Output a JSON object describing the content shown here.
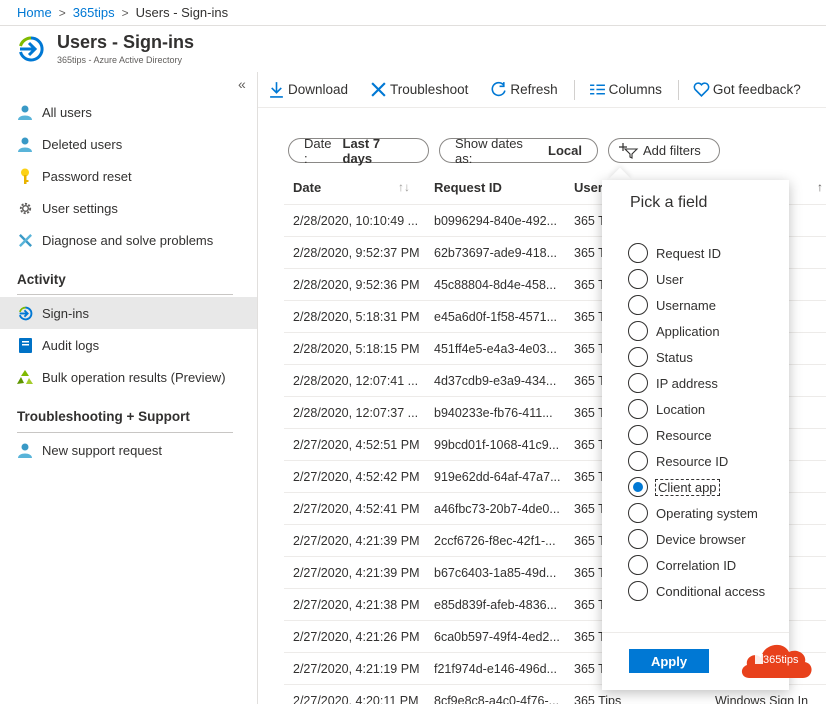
{
  "breadcrumb": {
    "home": "Home",
    "tenant": "365tips",
    "current": "Users - Sign-ins",
    "separator": ">"
  },
  "header": {
    "title": "Users - Sign-ins",
    "subtitle": "365tips - Azure Active Directory"
  },
  "sidebar": {
    "collapse_glyph": "«",
    "items": [
      {
        "label": "All users",
        "icon": "user-icon"
      },
      {
        "label": "Deleted users",
        "icon": "user-icon"
      },
      {
        "label": "Password reset",
        "icon": "key-icon"
      },
      {
        "label": "User settings",
        "icon": "gear-icon"
      },
      {
        "label": "Diagnose and solve problems",
        "icon": "wrench-icon"
      }
    ],
    "section_activity": "Activity",
    "activity_items": [
      {
        "label": "Sign-ins",
        "icon": "signin-icon",
        "active": true
      },
      {
        "label": "Audit logs",
        "icon": "book-icon"
      },
      {
        "label": "Bulk operation results (Preview)",
        "icon": "recycle-icon"
      }
    ],
    "section_support": "Troubleshooting + Support",
    "support_items": [
      {
        "label": "New support request",
        "icon": "user-icon"
      }
    ]
  },
  "toolbar": {
    "download": "Download",
    "troubleshoot": "Troubleshoot",
    "refresh": "Refresh",
    "columns": "Columns",
    "feedback": "Got feedback?"
  },
  "filters": {
    "date_label": "Date :",
    "date_value": "Last 7 days",
    "show_dates_label": "Show dates as:",
    "show_dates_value": "Local",
    "add_filters": "Add filters"
  },
  "table": {
    "columns": [
      "Date",
      "Request ID",
      "User"
    ],
    "rows": [
      [
        "2/28/2020, 10:10:49 ...",
        "b0996294-840e-492...",
        "365 T",
        ""
      ],
      [
        "2/28/2020, 9:52:37 PM",
        "62b73697-ade9-418...",
        "365 T",
        "n In"
      ],
      [
        "2/28/2020, 9:52:36 PM",
        "45c88804-8d4e-458...",
        "365 T",
        "n In"
      ],
      [
        "2/28/2020, 5:18:31 PM",
        "e45a6d0f-1f58-4571...",
        "365 T",
        "fice"
      ],
      [
        "2/28/2020, 5:18:15 PM",
        "451ff4e5-e4a3-4e03...",
        "365 T",
        "fice"
      ],
      [
        "2/28/2020, 12:07:41 ...",
        "4d37cdb9-e3a9-434...",
        "365 T",
        ""
      ],
      [
        "2/28/2020, 12:07:37 ...",
        "b940233e-fb76-411...",
        "365 T",
        ""
      ],
      [
        "2/27/2020, 4:52:51 PM",
        "99bcd01f-1068-41c9...",
        "365 T",
        ""
      ],
      [
        "2/27/2020, 4:52:42 PM",
        "919e62dd-64af-47a7...",
        "365 T",
        "n In"
      ],
      [
        "2/27/2020, 4:52:41 PM",
        "a46fbc73-20b7-4de0...",
        "365 T",
        "n In"
      ],
      [
        "2/27/2020, 4:21:39 PM",
        "2ccf6726-f8ec-42f1-...",
        "365 T",
        "ell WC"
      ],
      [
        "2/27/2020, 4:21:39 PM",
        "b67c6403-1a85-49d...",
        "365 T",
        "ell WC"
      ],
      [
        "2/27/2020, 4:21:38 PM",
        "e85d839f-afeb-4836...",
        "365 T",
        "ell WC"
      ],
      [
        "2/27/2020, 4:21:26 PM",
        "6ca0b597-49f4-4ed2...",
        "365 T",
        "change"
      ],
      [
        "2/27/2020, 4:21:19 PM",
        "f21f974d-e146-496d...",
        "365 T",
        ""
      ],
      [
        "2/27/2020, 4:20:11 PM",
        "8cf9e8c8-a4c0-4f76-...",
        "365 Tips",
        "Windows Sign In"
      ]
    ]
  },
  "pick_field": {
    "title": "Pick a field",
    "options": [
      "Request ID",
      "User",
      "Username",
      "Application",
      "Status",
      "IP address",
      "Location",
      "Resource",
      "Resource ID",
      "Client app",
      "Operating system",
      "Device browser",
      "Correlation ID",
      "Conditional access"
    ],
    "selected": "Client app",
    "apply": "Apply"
  },
  "watermark": {
    "text": "365tips"
  },
  "colors": {
    "accent": "#0078d4",
    "logo_orange": "#e8411c"
  }
}
